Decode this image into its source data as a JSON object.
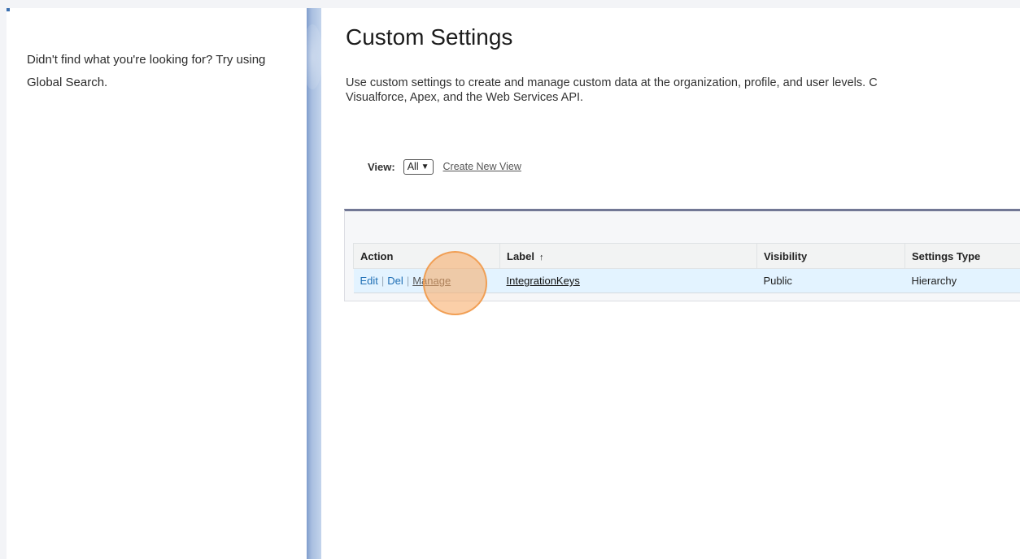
{
  "sidebar": {
    "hint": "Didn't find what you're looking for? Try using Global Search."
  },
  "page": {
    "title": "Custom Settings",
    "description": "Use custom settings to create and manage custom data at the organization, profile, and user levels. C\nVisualforce, Apex, and the Web Services API."
  },
  "view": {
    "label": "View:",
    "selected": "All",
    "create_link": "Create New View"
  },
  "table": {
    "headers": {
      "action": "Action",
      "label": "Label",
      "sort_indicator": "↑",
      "visibility": "Visibility",
      "settings_type": "Settings Type"
    },
    "rows": [
      {
        "edit": "Edit",
        "sep1": "|",
        "del": "Del",
        "sep2": "|",
        "manage": "Manage",
        "label": "IntegrationKeys",
        "visibility": "Public",
        "settings_type": "Hierarchy"
      }
    ]
  },
  "colors": {
    "link": "#1f6fb5",
    "row_highlight": "#e3f3ff",
    "list_border": "#727895",
    "divider": "#a9bfe0",
    "click_indicator": "#f7a860"
  },
  "icons": {
    "select_chevron": "chevron-down-icon",
    "sort": "sort-ascending-icon"
  }
}
